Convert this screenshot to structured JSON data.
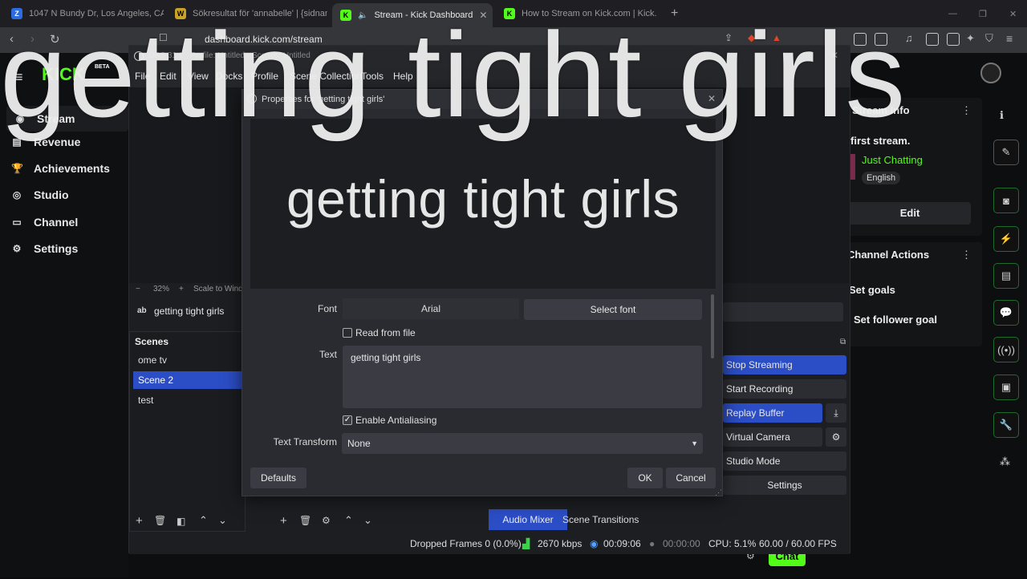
{
  "browser": {
    "tabs": [
      {
        "title": "1047 N Bundy Dr, Los Angeles, CA 90",
        "favicon": "Z"
      },
      {
        "title": "Sökresultat för 'annabelle' | {sidnamn",
        "favicon": "W"
      },
      {
        "title": "Stream - Kick Dashboard",
        "favicon": "K"
      },
      {
        "title": "How to Stream on Kick.com | Kick.co",
        "favicon": "K"
      }
    ],
    "url": "dashboard.kick.com/stream"
  },
  "overlay_title": "getting tight girls",
  "kick": {
    "logo": "KICK",
    "beta": "BETA",
    "nav": [
      "Stream",
      "Revenue",
      "Achievements",
      "Studio",
      "Channel",
      "Settings"
    ],
    "stream_info": {
      "header": "Stream Info",
      "title": "first stream.",
      "category": "Just Chatting",
      "language": "English",
      "edit": "Edit"
    },
    "channel_actions": {
      "header": "Channel Actions",
      "items": [
        "Set goals",
        "Set follower goal"
      ]
    },
    "chat_button": "Chat"
  },
  "obs": {
    "title": "OBS 31.1 - Profile: Untitled - Scenes: Untitled",
    "menu": [
      "File",
      "Edit",
      "View",
      "Docks",
      "Profile",
      "Scene Collection",
      "Tools",
      "Help"
    ],
    "zoom": "32%",
    "scale": "Scale to Window",
    "source_name": "getting tight girls",
    "scenes_header": "Scenes",
    "scenes": [
      "ome tv",
      "Scene 2",
      "test"
    ],
    "controls": [
      "Stop Streaming",
      "Start Recording",
      "Replay Buffer",
      "Virtual Camera",
      "Studio Mode",
      "Settings"
    ],
    "tabs": [
      "Audio Mixer",
      "Scene Transitions"
    ],
    "status": {
      "dropped": "Dropped Frames 0 (0.0%)",
      "bitrate": "2670 kbps",
      "stream_time": "00:09:06",
      "rec_time": "00:00:00",
      "cpu": "CPU: 5.1%",
      "fps": "60.00 / 60.00 FPS"
    }
  },
  "dialog": {
    "title": "Properties for 'getting tight girls'",
    "preview_text": "getting tight girls",
    "font_label": "Font",
    "font_value": "Arial",
    "select_font": "Select font",
    "read_from_file": "Read from file",
    "text_label": "Text",
    "text_value": "getting tight girls",
    "antialiasing": "Enable Antialiasing",
    "transform_label": "Text Transform",
    "transform_value": "None",
    "defaults": "Defaults",
    "ok": "OK",
    "cancel": "Cancel"
  }
}
